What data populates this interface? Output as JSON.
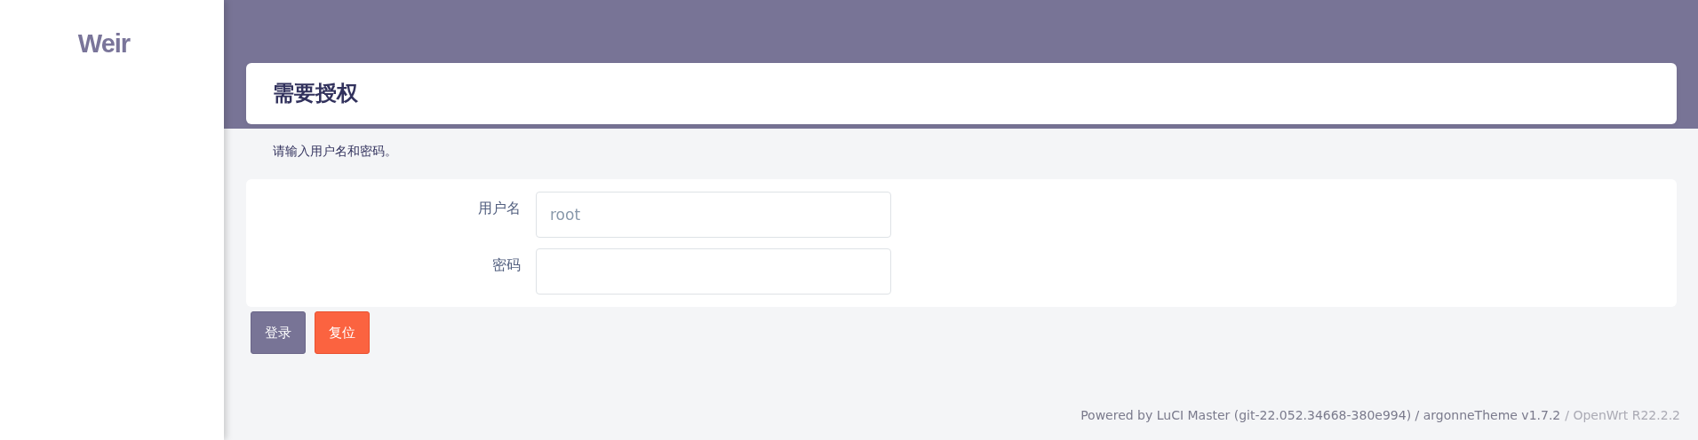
{
  "sidebar": {
    "logo": "Weir"
  },
  "page": {
    "title": "需要授权",
    "description": "请输入用户名和密码。"
  },
  "form": {
    "fields": [
      {
        "label": "用户名",
        "placeholder": "root"
      },
      {
        "label": "密码"
      }
    ]
  },
  "buttons": [
    {
      "label": "登录",
      "kind": "primary"
    },
    {
      "label": "复位",
      "kind": "reset"
    }
  ],
  "footer": [
    {
      "text": "Powered by LuCI Master (git-22.052.34668-380e994) / argonneTheme v1.7.2",
      "kind": "main"
    },
    {
      "text": "/ OpenWrt R22.2.2",
      "kind": "muted"
    }
  ]
}
